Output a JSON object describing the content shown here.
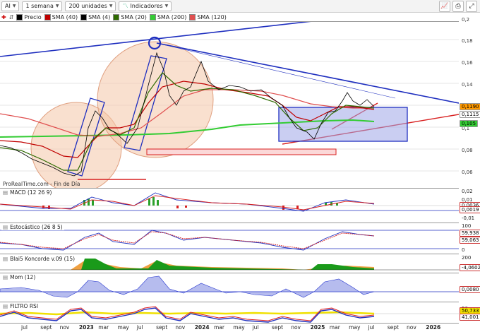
{
  "toolbar": {
    "symbol": "AI",
    "period": "1 semana",
    "units": "200 unidades",
    "indicators": "Indicadores",
    "chart_icon": "chart-icon",
    "print_icon": "print-icon",
    "fullscreen_icon": "fullscreen-icon"
  },
  "legend": [
    {
      "label": "Precio",
      "color": "#000000"
    },
    {
      "label": "SMA (40)",
      "color": "#c00000"
    },
    {
      "label": "SMA (4)",
      "color": "#000000"
    },
    {
      "label": "SMA (20)",
      "color": "#2e6b00"
    },
    {
      "label": "SMA (200)",
      "color": "#33cc33"
    },
    {
      "label": "SMA (120)",
      "color": "#e05050"
    }
  ],
  "price_axis": [
    "0,2",
    "0,18",
    "0,16",
    "0,14",
    "0,12",
    "0,1",
    "0,08",
    "0,06"
  ],
  "price_tags": [
    {
      "text": "0,1190",
      "bg": "#ff9900"
    },
    {
      "text": "0,1115",
      "bg": "#ffffff"
    },
    {
      "text": "0,105",
      "bg": "#33cc33"
    }
  ],
  "footer_text": "ProRealTime.com - Fin de Día",
  "panels": {
    "macd": {
      "label": "MACD (12 26 9)",
      "axis": [
        "0,02",
        "0,01",
        "-0,01"
      ],
      "tags": [
        "0,0036",
        "0,0019"
      ]
    },
    "stoch": {
      "label": "Estocástico (26 8 5)",
      "axis": [
        "100",
        "0"
      ],
      "tags": [
        "59,938",
        "59,063"
      ]
    },
    "blai5": {
      "label": "Blai5 Koncorde v.09 (15)",
      "axis": [
        "200",
        "0"
      ],
      "tags": [
        "-4,0602"
      ]
    },
    "mom": {
      "label": "Mom (12)",
      "axis": [
        "0,0080"
      ],
      "tags": [
        "0,0080"
      ]
    },
    "rsi": {
      "label": "FILTRO RSI",
      "axis": [
        "50"
      ],
      "tags": [
        "50,733",
        "41,001"
      ]
    }
  },
  "xaxis": [
    {
      "t": "jul",
      "yr": false
    },
    {
      "t": "sept",
      "yr": false
    },
    {
      "t": "nov",
      "yr": false
    },
    {
      "t": "2023",
      "yr": true
    },
    {
      "t": "mar",
      "yr": false
    },
    {
      "t": "may",
      "yr": false
    },
    {
      "t": "jul",
      "yr": false
    },
    {
      "t": "sept",
      "yr": false
    },
    {
      "t": "nov",
      "yr": false
    },
    {
      "t": "2024",
      "yr": true
    },
    {
      "t": "mar",
      "yr": false
    },
    {
      "t": "may",
      "yr": false
    },
    {
      "t": "jul",
      "yr": false
    },
    {
      "t": "sept",
      "yr": false
    },
    {
      "t": "nov",
      "yr": false
    },
    {
      "t": "2025",
      "yr": true
    },
    {
      "t": "mar",
      "yr": false
    },
    {
      "t": "may",
      "yr": false
    },
    {
      "t": "jul",
      "yr": false
    },
    {
      "t": "sept",
      "yr": false
    },
    {
      "t": "nov",
      "yr": false
    },
    {
      "t": "2026",
      "yr": true
    }
  ]
}
